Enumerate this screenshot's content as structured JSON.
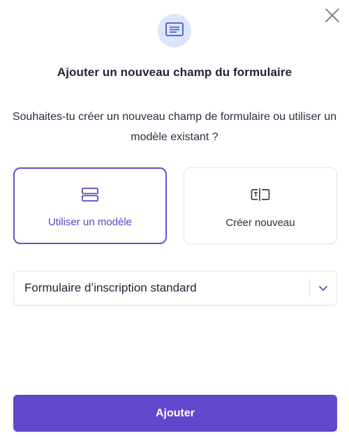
{
  "dialog": {
    "title": "Ajouter un nouveau champ du formulaire",
    "subtitle": "Souhaites-tu créer un nouveau champ de formulaire ou utiliser un modèle existant ?",
    "header_icon": "form-icon",
    "close_icon": "close-icon"
  },
  "options": [
    {
      "label": "Utiliser un modèle",
      "icon": "template-stack-icon",
      "selected": true
    },
    {
      "label": "Créer nouveau",
      "icon": "text-field-icon",
      "selected": false
    }
  ],
  "template_select": {
    "value": "Formulaire d’inscription standard",
    "icon": "chevron-down-icon"
  },
  "submit": {
    "label": "Ajouter"
  },
  "colors": {
    "accent": "#6247cd",
    "accent_text": "#5b45c4",
    "header_icon_bg": "#dce6fa",
    "border": "#e3e5ea"
  }
}
